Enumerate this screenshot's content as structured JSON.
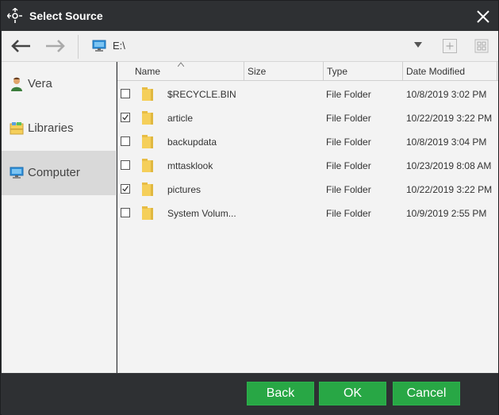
{
  "title": "Select Source",
  "toolbar": {
    "path": "E:\\"
  },
  "sidebar": {
    "items": [
      {
        "label": "Vera",
        "icon": "user-icon"
      },
      {
        "label": "Libraries",
        "icon": "libraries-icon"
      },
      {
        "label": "Computer",
        "icon": "computer-icon",
        "active": true
      }
    ]
  },
  "columns": {
    "name": "Name",
    "size": "Size",
    "type": "Type",
    "date": "Date Modified"
  },
  "rows": [
    {
      "name": "$RECYCLE.BIN",
      "type": "File Folder",
      "date": "10/8/2019 3:02 PM",
      "checked": false
    },
    {
      "name": "article",
      "type": "File Folder",
      "date": "10/22/2019 3:22 PM",
      "checked": true
    },
    {
      "name": "backupdata",
      "type": "File Folder",
      "date": "10/8/2019 3:04 PM",
      "checked": false
    },
    {
      "name": "mttasklook",
      "type": "File Folder",
      "date": "10/23/2019 8:08 AM",
      "checked": false
    },
    {
      "name": "pictures",
      "type": "File Folder",
      "date": "10/22/2019 3:22 PM",
      "checked": true
    },
    {
      "name": "System Volum...",
      "type": "File Folder",
      "date": "10/9/2019 2:55 PM",
      "checked": false
    }
  ],
  "buttons": {
    "back": "Back",
    "ok": "OK",
    "cancel": "Cancel"
  },
  "colors": {
    "accent": "#28a745",
    "titlebar": "#2e3033",
    "folder": "#f5cf5a"
  }
}
